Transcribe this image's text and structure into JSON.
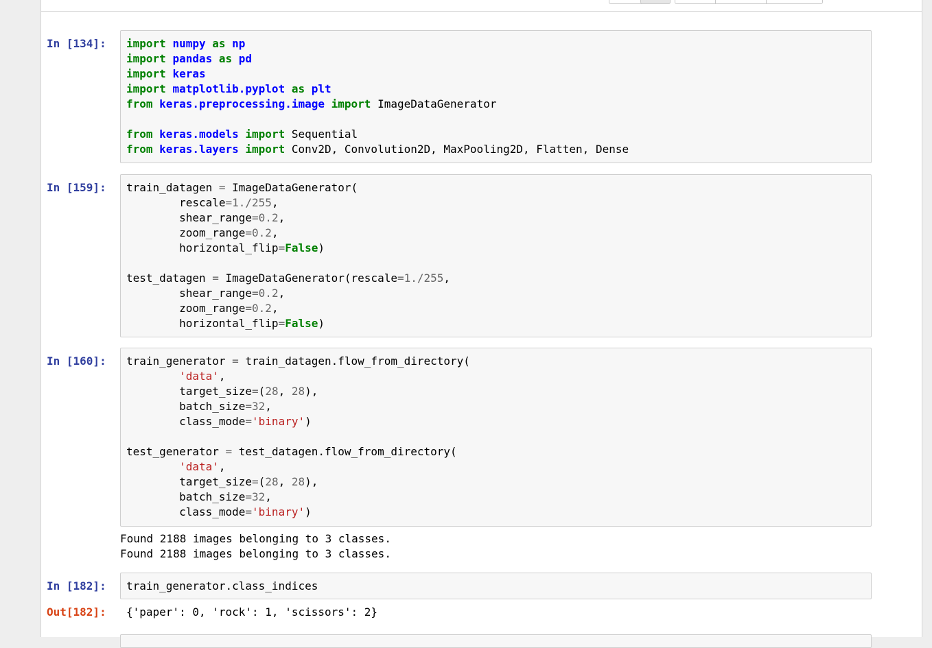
{
  "cells": [
    {
      "prompt": "In [134]:",
      "lines": [
        [
          [
            "kw",
            "import"
          ],
          [
            "t",
            " "
          ],
          [
            "nn",
            "numpy"
          ],
          [
            "t",
            " "
          ],
          [
            "kw",
            "as"
          ],
          [
            "t",
            " "
          ],
          [
            "nn",
            "np"
          ]
        ],
        [
          [
            "kw",
            "import"
          ],
          [
            "t",
            " "
          ],
          [
            "nn",
            "pandas"
          ],
          [
            "t",
            " "
          ],
          [
            "kw",
            "as"
          ],
          [
            "t",
            " "
          ],
          [
            "nn",
            "pd"
          ]
        ],
        [
          [
            "kw",
            "import"
          ],
          [
            "t",
            " "
          ],
          [
            "nn",
            "keras"
          ]
        ],
        [
          [
            "kw",
            "import"
          ],
          [
            "t",
            " "
          ],
          [
            "nn",
            "matplotlib.pyplot"
          ],
          [
            "t",
            " "
          ],
          [
            "kw",
            "as"
          ],
          [
            "t",
            " "
          ],
          [
            "nn",
            "plt"
          ]
        ],
        [
          [
            "kw",
            "from"
          ],
          [
            "t",
            " "
          ],
          [
            "nn",
            "keras.preprocessing.image"
          ],
          [
            "t",
            " "
          ],
          [
            "kw",
            "import"
          ],
          [
            "t",
            " ImageDataGenerator"
          ]
        ],
        [],
        [
          [
            "kw",
            "from"
          ],
          [
            "t",
            " "
          ],
          [
            "nn",
            "keras.models"
          ],
          [
            "t",
            " "
          ],
          [
            "kw",
            "import"
          ],
          [
            "t",
            " Sequential"
          ]
        ],
        [
          [
            "kw",
            "from"
          ],
          [
            "t",
            " "
          ],
          [
            "nn",
            "keras.layers"
          ],
          [
            "t",
            " "
          ],
          [
            "kw",
            "import"
          ],
          [
            "t",
            " Conv2D, Convolution2D, MaxPooling2D, Flatten, Dense"
          ]
        ]
      ]
    },
    {
      "prompt": "In [159]:",
      "lines": [
        [
          [
            "t",
            "train_datagen "
          ],
          [
            "op",
            "="
          ],
          [
            "t",
            " ImageDataGenerator("
          ]
        ],
        [
          [
            "t",
            "        rescale"
          ],
          [
            "op",
            "="
          ],
          [
            "num",
            "1./255"
          ],
          [
            "t",
            ","
          ]
        ],
        [
          [
            "t",
            "        shear_range"
          ],
          [
            "op",
            "="
          ],
          [
            "num",
            "0.2"
          ],
          [
            "t",
            ","
          ]
        ],
        [
          [
            "t",
            "        zoom_range"
          ],
          [
            "op",
            "="
          ],
          [
            "num",
            "0.2"
          ],
          [
            "t",
            ","
          ]
        ],
        [
          [
            "t",
            "        horizontal_flip"
          ],
          [
            "op",
            "="
          ],
          [
            "kw",
            "False"
          ],
          [
            "t",
            ")"
          ]
        ],
        [],
        [
          [
            "t",
            "test_datagen "
          ],
          [
            "op",
            "="
          ],
          [
            "t",
            " ImageDataGenerator(rescale"
          ],
          [
            "op",
            "="
          ],
          [
            "num",
            "1./255"
          ],
          [
            "t",
            ","
          ]
        ],
        [
          [
            "t",
            "        shear_range"
          ],
          [
            "op",
            "="
          ],
          [
            "num",
            "0.2"
          ],
          [
            "t",
            ","
          ]
        ],
        [
          [
            "t",
            "        zoom_range"
          ],
          [
            "op",
            "="
          ],
          [
            "num",
            "0.2"
          ],
          [
            "t",
            ","
          ]
        ],
        [
          [
            "t",
            "        horizontal_flip"
          ],
          [
            "op",
            "="
          ],
          [
            "kw",
            "False"
          ],
          [
            "t",
            ")"
          ]
        ]
      ]
    },
    {
      "prompt": "In [160]:",
      "lines": [
        [
          [
            "t",
            "train_generator "
          ],
          [
            "op",
            "="
          ],
          [
            "t",
            " train_datagen.flow_from_directory("
          ]
        ],
        [
          [
            "t",
            "        "
          ],
          [
            "str",
            "'data'"
          ],
          [
            "t",
            ","
          ]
        ],
        [
          [
            "t",
            "        target_size"
          ],
          [
            "op",
            "="
          ],
          [
            "t",
            "("
          ],
          [
            "num",
            "28"
          ],
          [
            "t",
            ", "
          ],
          [
            "num",
            "28"
          ],
          [
            "t",
            "),"
          ]
        ],
        [
          [
            "t",
            "        batch_size"
          ],
          [
            "op",
            "="
          ],
          [
            "num",
            "32"
          ],
          [
            "t",
            ","
          ]
        ],
        [
          [
            "t",
            "        class_mode"
          ],
          [
            "op",
            "="
          ],
          [
            "str",
            "'binary'"
          ],
          [
            "t",
            ")"
          ]
        ],
        [],
        [
          [
            "t",
            "test_generator "
          ],
          [
            "op",
            "="
          ],
          [
            "t",
            " test_datagen.flow_from_directory("
          ]
        ],
        [
          [
            "t",
            "        "
          ],
          [
            "str",
            "'data'"
          ],
          [
            "t",
            ","
          ]
        ],
        [
          [
            "t",
            "        target_size"
          ],
          [
            "op",
            "="
          ],
          [
            "t",
            "("
          ],
          [
            "num",
            "28"
          ],
          [
            "t",
            ", "
          ],
          [
            "num",
            "28"
          ],
          [
            "t",
            "),"
          ]
        ],
        [
          [
            "t",
            "        batch_size"
          ],
          [
            "op",
            "="
          ],
          [
            "num",
            "32"
          ],
          [
            "t",
            ","
          ]
        ],
        [
          [
            "t",
            "        class_mode"
          ],
          [
            "op",
            "="
          ],
          [
            "str",
            "'binary'"
          ],
          [
            "t",
            ")"
          ]
        ]
      ],
      "output": "Found 2188 images belonging to 3 classes.\nFound 2188 images belonging to 3 classes."
    },
    {
      "prompt": "In [182]:",
      "lines": [
        [
          [
            "t",
            "train_generator.class_indices"
          ]
        ]
      ],
      "out_prompt": "Out[182]:",
      "output": "{'paper': 0, 'rock': 1, 'scissors': 2}"
    }
  ],
  "syntax_colors": {
    "keyword": "#008000",
    "namespace": "#0000ff",
    "number": "#666666",
    "string": "#ba2121",
    "prompt_in": "#303f9f",
    "prompt_out": "#d84315"
  }
}
